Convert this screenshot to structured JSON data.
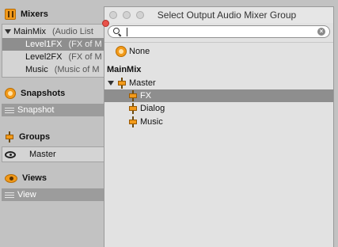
{
  "panel": {
    "mixers": {
      "title": "Mixers",
      "items": [
        {
          "name": "MainMix",
          "desc": "(Audio List"
        },
        {
          "name": "Level1FX",
          "desc": "(FX of M"
        },
        {
          "name": "Level2FX",
          "desc": "(FX of M"
        },
        {
          "name": "Music",
          "desc": "(Music of M"
        }
      ]
    },
    "snapshots": {
      "title": "Snapshots",
      "bar_label": "Snapshot"
    },
    "groups": {
      "title": "Groups",
      "item": "Master"
    },
    "views": {
      "title": "Views",
      "bar_label": "View"
    }
  },
  "popup": {
    "title": "Select Output Audio Mixer Group",
    "search_value": "",
    "none_label": "None",
    "mixer_header": "MainMix",
    "tree": {
      "root": "Master",
      "children": [
        "FX",
        "Dialog",
        "Music"
      ],
      "selected": "FX"
    }
  },
  "colors": {
    "accent": "#f29a1a",
    "selection": "#8e8e8e"
  }
}
